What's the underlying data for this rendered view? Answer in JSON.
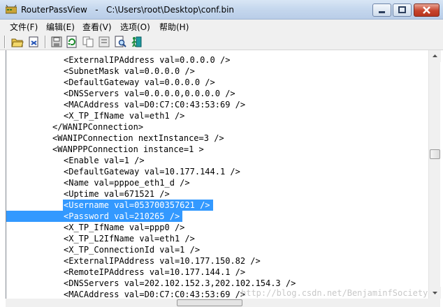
{
  "window": {
    "title": "RouterPassView   -   C:\\Users\\root\\Desktop\\conf.bin"
  },
  "menu": [
    {
      "label": "文件(F)"
    },
    {
      "label": "编辑(E)"
    },
    {
      "label": "查看(V)"
    },
    {
      "label": "选项(O)"
    },
    {
      "label": "帮助(H)"
    }
  ],
  "toolbar": [
    {
      "icon": "open-folder-icon"
    },
    {
      "icon": "open-config-icon"
    },
    {
      "icon": "save-icon"
    },
    {
      "icon": "refresh-icon"
    },
    {
      "icon": "copy-icon"
    },
    {
      "icon": "properties-icon"
    },
    {
      "icon": "find-icon"
    },
    {
      "icon": "exit-icon"
    }
  ],
  "content": {
    "lines": [
      {
        "text": "<ExternalIPAddress val=0.0.0.0 />",
        "indent": 2,
        "selected": false
      },
      {
        "text": "<SubnetMask val=0.0.0.0 />",
        "indent": 2,
        "selected": false
      },
      {
        "text": "<DefaultGateway val=0.0.0.0 />",
        "indent": 2,
        "selected": false
      },
      {
        "text": "<DNSServers val=0.0.0.0,0.0.0.0 />",
        "indent": 2,
        "selected": false
      },
      {
        "text": "<MACAddress val=D0:C7:C0:43:53:69 />",
        "indent": 2,
        "selected": false
      },
      {
        "text": "<X_TP_IfName val=eth1 />",
        "indent": 2,
        "selected": false
      },
      {
        "text": "</WANIPConnection>",
        "indent": 1,
        "selected": false
      },
      {
        "text": "<WANIPConnection nextInstance=3 />",
        "indent": 1,
        "selected": false
      },
      {
        "text": "<WANPPPConnection instance=1 >",
        "indent": 1,
        "selected": false
      },
      {
        "text": "<Enable val=1 />",
        "indent": 2,
        "selected": false
      },
      {
        "text": "<DefaultGateway val=10.177.144.1 />",
        "indent": 2,
        "selected": false
      },
      {
        "text": "<Name val=pppoe_eth1_d />",
        "indent": 2,
        "selected": false
      },
      {
        "text": "<Uptime val=671521 />",
        "indent": 2,
        "selected": false
      },
      {
        "text": "<Username val=053700357621 />",
        "indent": 2,
        "selected": true
      },
      {
        "text": "<Password val=210265 />",
        "indent": 2,
        "selected": true
      },
      {
        "text": "<X_TP_IfName val=ppp0 />",
        "indent": 2,
        "selected": false
      },
      {
        "text": "<X_TP_L2IfName val=eth1 />",
        "indent": 2,
        "selected": false
      },
      {
        "text": "<X_TP_ConnectionId val=1 />",
        "indent": 2,
        "selected": false
      },
      {
        "text": "<ExternalIPAddress val=10.177.150.82 />",
        "indent": 2,
        "selected": false
      },
      {
        "text": "<RemoteIPAddress val=10.177.144.1 />",
        "indent": 2,
        "selected": false
      },
      {
        "text": "<DNSServers val=202.102.152.3,202.102.154.3 />",
        "indent": 2,
        "selected": false
      },
      {
        "text": "<MACAddress val=D0:C7:C0:43:53:69 />",
        "indent": 2,
        "selected": false
      }
    ]
  },
  "watermark": "http://blog.csdn.net/BenjaminfSociety"
}
